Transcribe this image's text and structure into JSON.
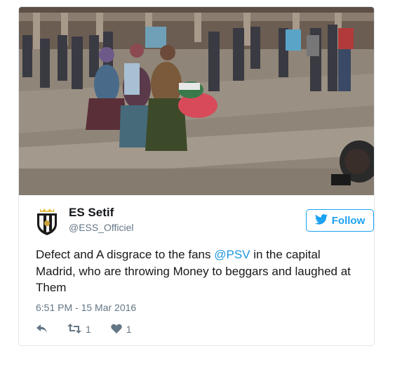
{
  "tweet": {
    "display_name": "ES Setif",
    "handle": "@ESS_Officiel",
    "follow_label": "Follow",
    "text_before": "Defect and A disgrace to the fans ",
    "mention": "@PSV",
    "text_after": " in the capital Madrid, who are throwing Money to beggars and laughed at Them",
    "timestamp": "6:51 PM - 15 Mar 2016",
    "retweet_count": "1",
    "like_count": "1"
  },
  "icons": {
    "avatar": "es-setif-crest-icon",
    "follow": "twitter-bird-icon",
    "reply": "reply-icon",
    "retweet": "retweet-icon",
    "like": "heart-icon"
  },
  "colors": {
    "accent": "#1da1f2",
    "mention": "#1b95e0",
    "text": "#14171a",
    "muted": "#657786",
    "border": "#e1e8ed"
  }
}
